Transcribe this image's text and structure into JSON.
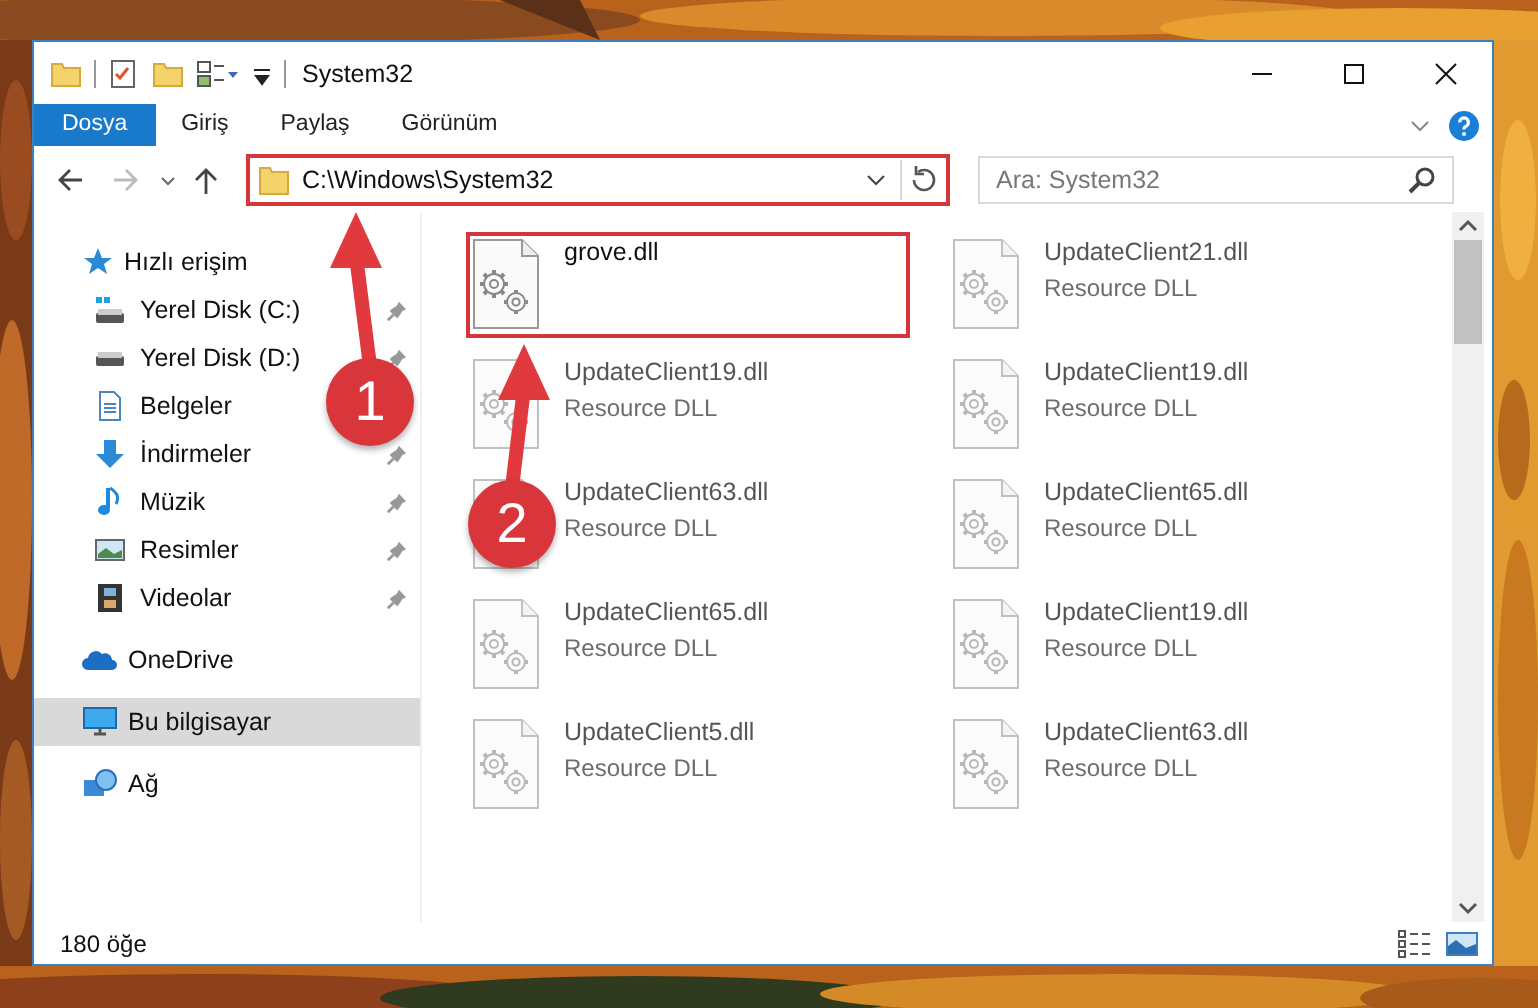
{
  "window": {
    "title": "System32"
  },
  "ribbon": {
    "tabs": [
      {
        "label": "Dosya",
        "kind": "file"
      },
      {
        "label": "Giriş",
        "kind": "tab"
      },
      {
        "label": "Paylaş",
        "kind": "tab"
      },
      {
        "label": "Görünüm",
        "kind": "tab"
      }
    ]
  },
  "address_bar": {
    "path": "C:\\Windows\\System32",
    "highlighted": true
  },
  "search": {
    "placeholder": "Ara: System32"
  },
  "navigation": [
    {
      "label": "Hızlı erişim",
      "kind": "star",
      "selected": false,
      "children": [
        {
          "label": "Yerel Disk (C:)",
          "kind": "drive-c",
          "pinned": true,
          "selected": false
        },
        {
          "label": "Yerel Disk (D:)",
          "kind": "drive",
          "pinned": true,
          "selected": false
        },
        {
          "label": "Belgeler",
          "kind": "documents",
          "pinned": false,
          "selected": false
        },
        {
          "label": "İndirmeler",
          "kind": "downloads",
          "pinned": true,
          "selected": false
        },
        {
          "label": "Müzik",
          "kind": "music",
          "pinned": true,
          "selected": false
        },
        {
          "label": "Resimler",
          "kind": "pictures",
          "pinned": true,
          "selected": false
        },
        {
          "label": "Videolar",
          "kind": "videos",
          "pinned": true,
          "selected": false
        }
      ]
    },
    {
      "label": "OneDrive",
      "kind": "cloud",
      "selected": false
    },
    {
      "label": "Bu bilgisayar",
      "kind": "computer",
      "selected": true
    },
    {
      "label": "Ağ",
      "kind": "network",
      "selected": false
    }
  ],
  "files": [
    {
      "name": "grove.dll",
      "highlighted": true
    },
    {
      "name": "UpdateClient21.dll",
      "type": "Resource DLL",
      "highlighted": false
    },
    {
      "name": "UpdateClient19.dll",
      "type": "Resource DLL",
      "highlighted": false
    },
    {
      "name": "UpdateClient19.dll",
      "type": "Resource DLL",
      "highlighted": false
    },
    {
      "name": "UpdateClient63.dll",
      "type": "Resource DLL",
      "highlighted": false
    },
    {
      "name": "UpdateClient65.dll",
      "type": "Resource DLL",
      "highlighted": false
    },
    {
      "name": "UpdateClient65.dll",
      "type": "Resource DLL",
      "highlighted": false
    },
    {
      "name": "UpdateClient19.dll",
      "type": "Resource DLL",
      "highlighted": false
    },
    {
      "name": "UpdateClient5.dll",
      "type": "Resource DLL",
      "highlighted": false
    },
    {
      "name": "UpdateClient63.dll",
      "type": "Resource DLL",
      "highlighted": false
    }
  ],
  "status_bar": {
    "item_count": "180 öğe"
  },
  "steps": [
    {
      "number": "1"
    },
    {
      "number": "2"
    }
  ]
}
